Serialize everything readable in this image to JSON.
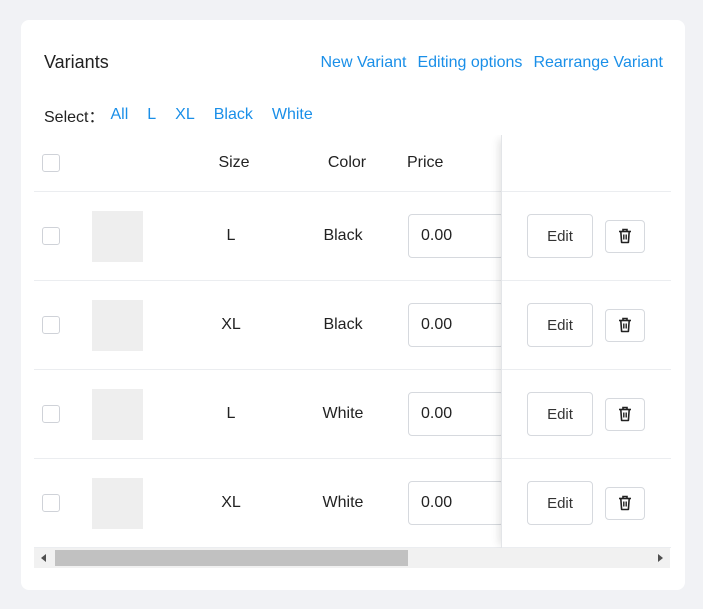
{
  "card": {
    "title": "Variants",
    "actions": {
      "new_variant": "New Variant",
      "editing_options": "Editing options",
      "rearrange_variant": "Rearrange Variant"
    }
  },
  "select": {
    "label": "Select：",
    "options": [
      "All",
      "L",
      "XL",
      "Black",
      "White"
    ]
  },
  "table": {
    "headers": {
      "size": "Size",
      "color": "Color",
      "price": "Price"
    },
    "rows": [
      {
        "size": "L",
        "color": "Black",
        "price": "0.00"
      },
      {
        "size": "XL",
        "color": "Black",
        "price": "0.00"
      },
      {
        "size": "L",
        "color": "White",
        "price": "0.00"
      },
      {
        "size": "XL",
        "color": "White",
        "price": "0.00"
      }
    ],
    "edit_label": "Edit"
  },
  "icons": {
    "delete": "trash-icon",
    "scroll_left": "triangle-left-icon",
    "scroll_right": "triangle-right-icon"
  },
  "colors": {
    "link": "#1a8fe8",
    "background": "#f1f2f5",
    "card": "#ffffff",
    "thumbnail": "#eeeeee"
  }
}
